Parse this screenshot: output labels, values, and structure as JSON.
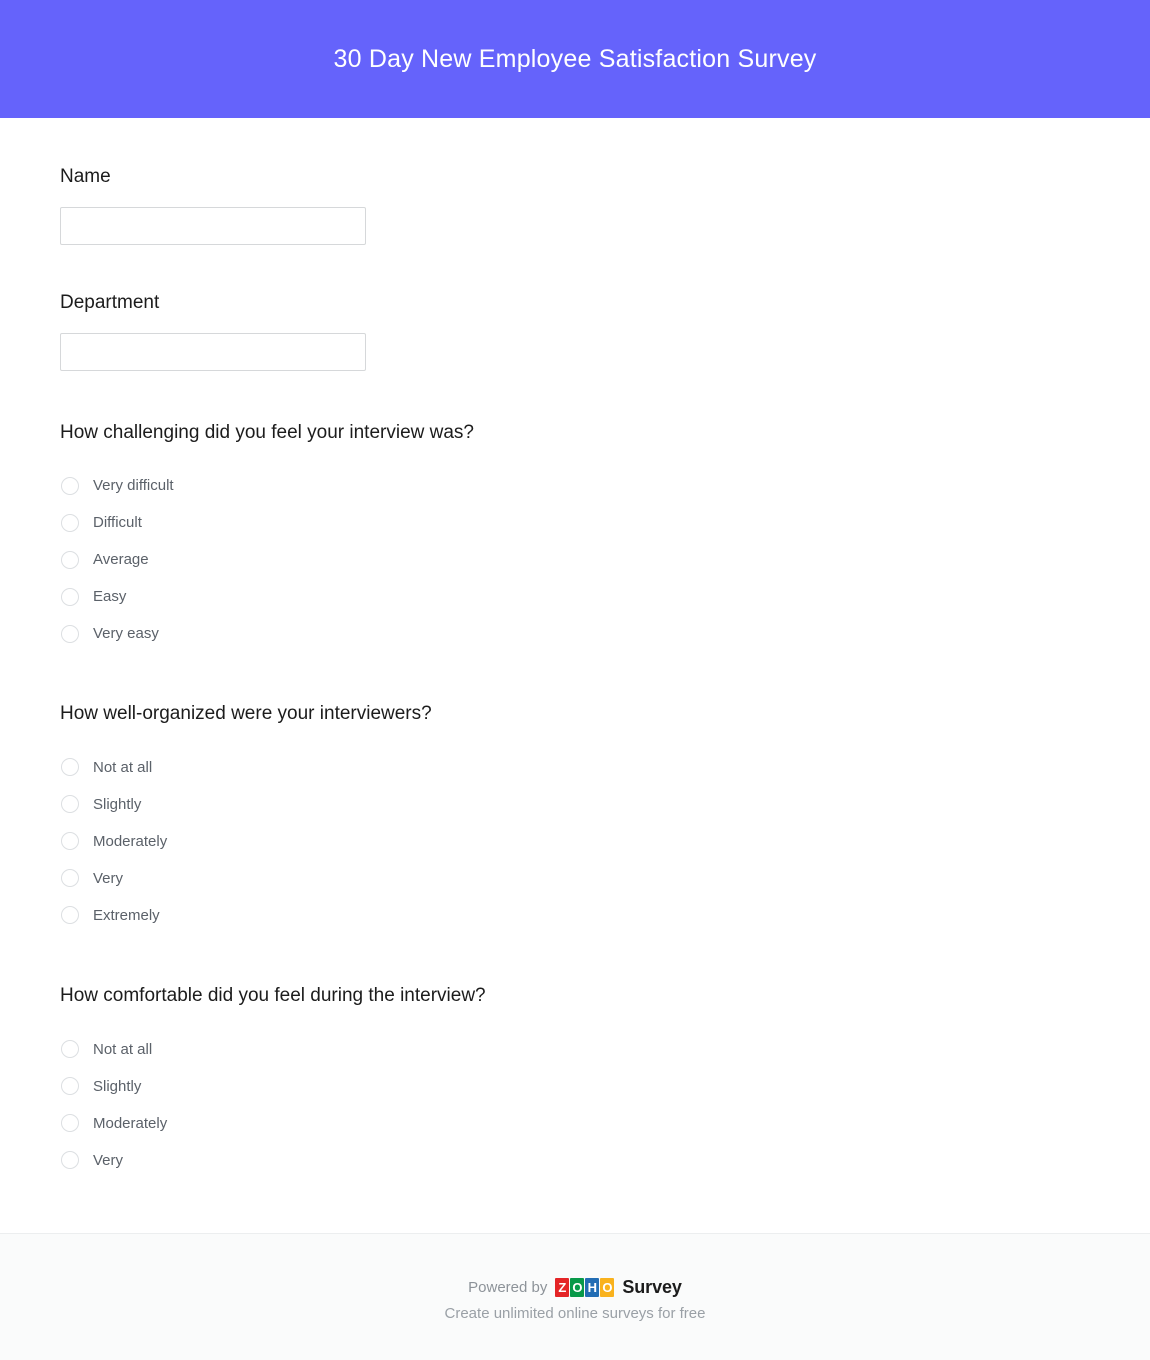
{
  "header": {
    "title": "30 Day New Employee Satisfaction Survey",
    "background_color": "#6563fb",
    "title_color": "#ffffff"
  },
  "fields": [
    {
      "label": "Name",
      "value": "",
      "placeholder": ""
    },
    {
      "label": "Department",
      "value": "",
      "placeholder": ""
    }
  ],
  "questions": [
    {
      "title": "How challenging did you feel your interview was?",
      "options": [
        {
          "label": "Very difficult",
          "selected": false
        },
        {
          "label": "Difficult",
          "selected": false
        },
        {
          "label": "Average",
          "selected": false
        },
        {
          "label": "Easy",
          "selected": false
        },
        {
          "label": "Very easy",
          "selected": false
        }
      ]
    },
    {
      "title": "How well-organized were your interviewers?",
      "options": [
        {
          "label": "Not at all",
          "selected": false
        },
        {
          "label": "Slightly",
          "selected": false
        },
        {
          "label": "Moderately",
          "selected": false
        },
        {
          "label": "Very",
          "selected": false
        },
        {
          "label": "Extremely",
          "selected": false
        }
      ]
    },
    {
      "title": "How comfortable did you feel during the interview?",
      "options": [
        {
          "label": "Not at all",
          "selected": false
        },
        {
          "label": "Slightly",
          "selected": false
        },
        {
          "label": "Moderately",
          "selected": false
        },
        {
          "label": "Very",
          "selected": false
        }
      ]
    }
  ],
  "footer": {
    "powered_by": "Powered by",
    "brand_letters": [
      "Z",
      "O",
      "H",
      "O"
    ],
    "brand_colors": [
      "#e42527",
      "#089949",
      "#226db4",
      "#f9b21d"
    ],
    "product": "Survey",
    "tagline": "Create unlimited online surveys for free"
  }
}
